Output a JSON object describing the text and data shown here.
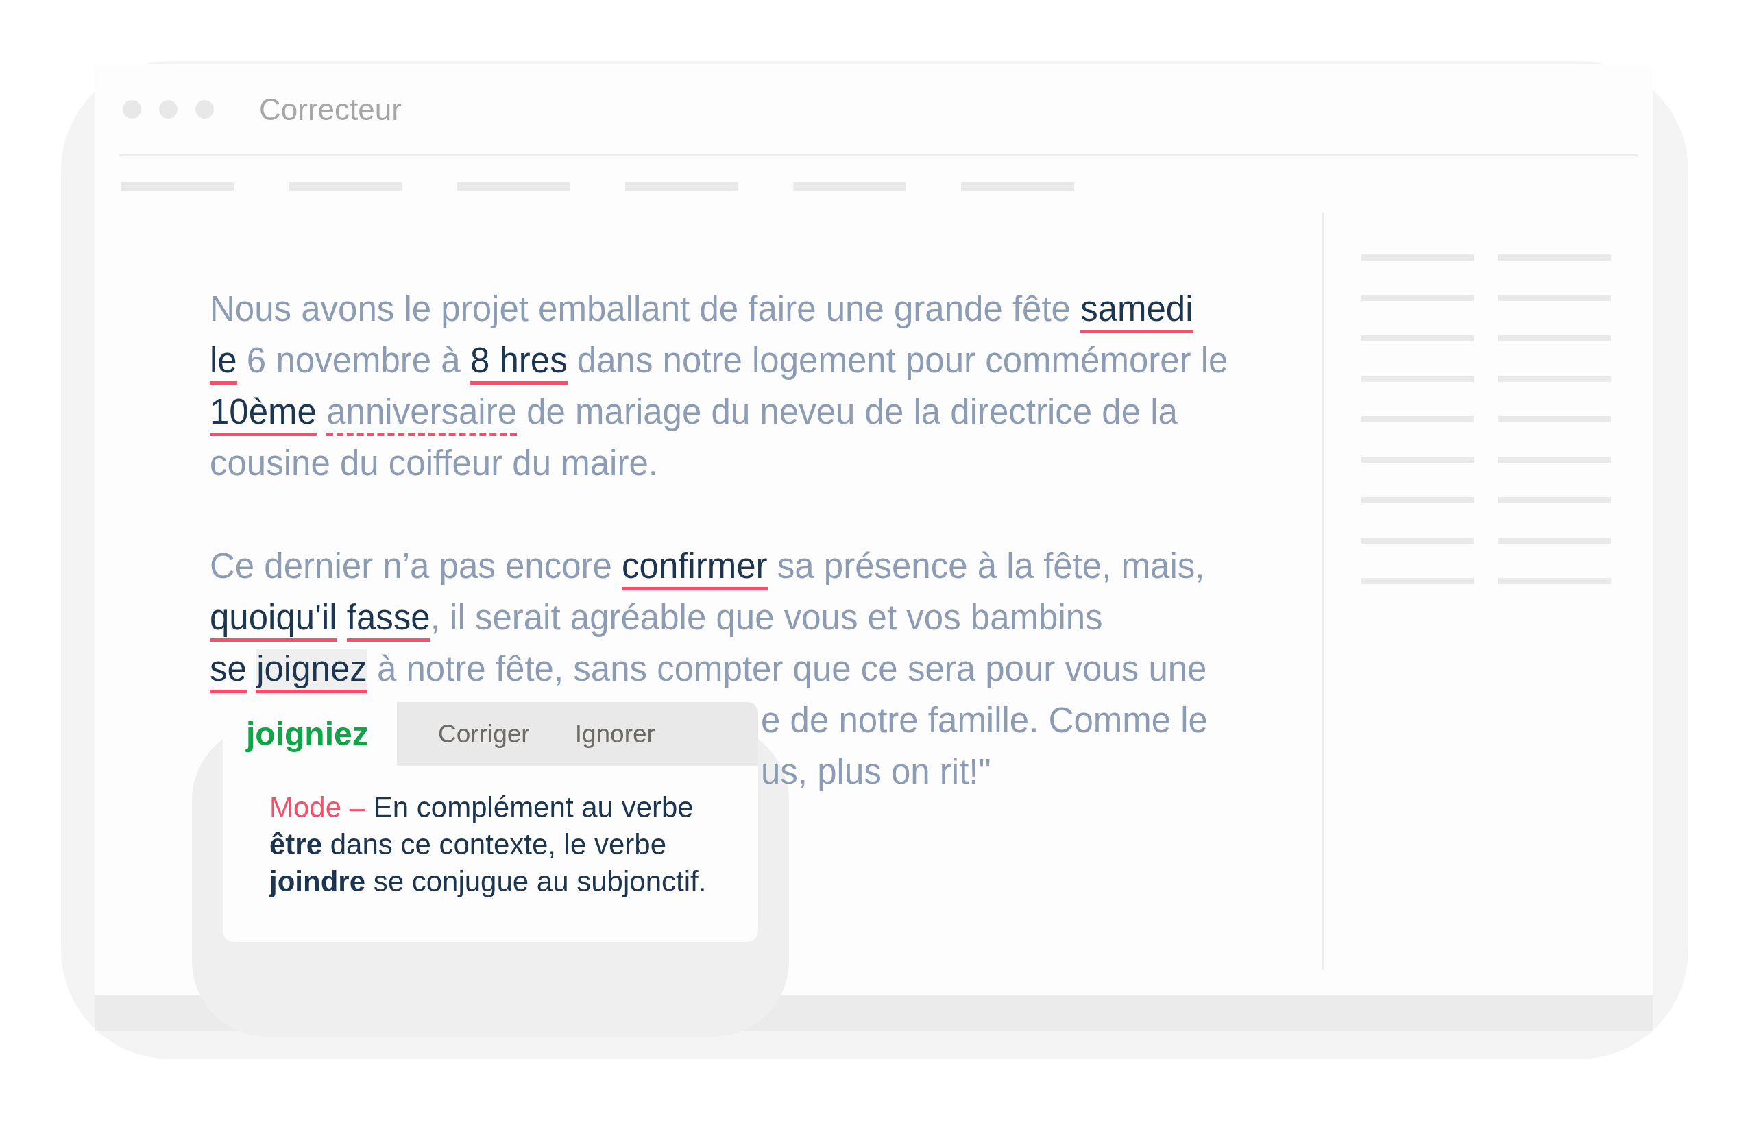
{
  "window": {
    "title": "Correcteur"
  },
  "document": {
    "paragraphs": [
      {
        "lines": [
          [
            {
              "kind": "plain",
              "text": "Nous avons le projet emballant de faire une grande fête "
            },
            {
              "kind": "error",
              "text": "samedi",
              "selected": false
            }
          ],
          [
            {
              "kind": "error",
              "text": "le",
              "selected": false
            },
            {
              "kind": "plain",
              "text": " 6 novembre à "
            },
            {
              "kind": "error",
              "text": "8 hres",
              "selected": false
            },
            {
              "kind": "plain",
              "text": " dans notre logement pour commémorer le"
            }
          ],
          [
            {
              "kind": "error",
              "text": "10ème",
              "selected": false
            },
            {
              "kind": "suggestion",
              "text": "anniversaire",
              "selected": false
            },
            {
              "kind": "plain",
              "text": " de mariage du neveu de la directrice de la"
            }
          ],
          [
            {
              "kind": "plain",
              "text": "cousine du coiffeur du maire."
            }
          ]
        ]
      },
      {
        "lines": [
          [
            {
              "kind": "plain",
              "text": "Ce dernier n’a pas encore "
            },
            {
              "kind": "error",
              "text": "confirmer",
              "selected": false
            },
            {
              "kind": "plain",
              "text": " sa présence à la fête, mais,"
            }
          ],
          [
            {
              "kind": "error",
              "text": "quoiqu'il",
              "selected": false
            },
            {
              "kind": "error",
              "text": "fasse",
              "selected": false
            },
            {
              "kind": "plain",
              "text": ", il serait agréable que vous et vos bambins"
            }
          ],
          [
            {
              "kind": "error",
              "text": "se",
              "selected": false
            },
            {
              "kind": "error",
              "text": "joignez",
              "selected": true
            },
            {
              "kind": "plain",
              "text": " à notre fête, sans compter que ce sera pour vous une"
            }
          ],
          [
            {
              "kind": "hidden"
            },
            {
              "kind": "plain",
              "text": "e de notre famille. Comme le"
            }
          ],
          [
            {
              "kind": "hidden"
            },
            {
              "kind": "plain",
              "text": "us, plus on rit!\""
            }
          ]
        ]
      }
    ]
  },
  "popup": {
    "word": "joigniez",
    "actions": [
      {
        "label": "Corriger"
      },
      {
        "label": "Ignorer"
      }
    ],
    "category": "Mode –",
    "explanation": "En complément au verbe **être** dans ce contexte, le verbe **joindre** se conjugue au subjonctif."
  }
}
